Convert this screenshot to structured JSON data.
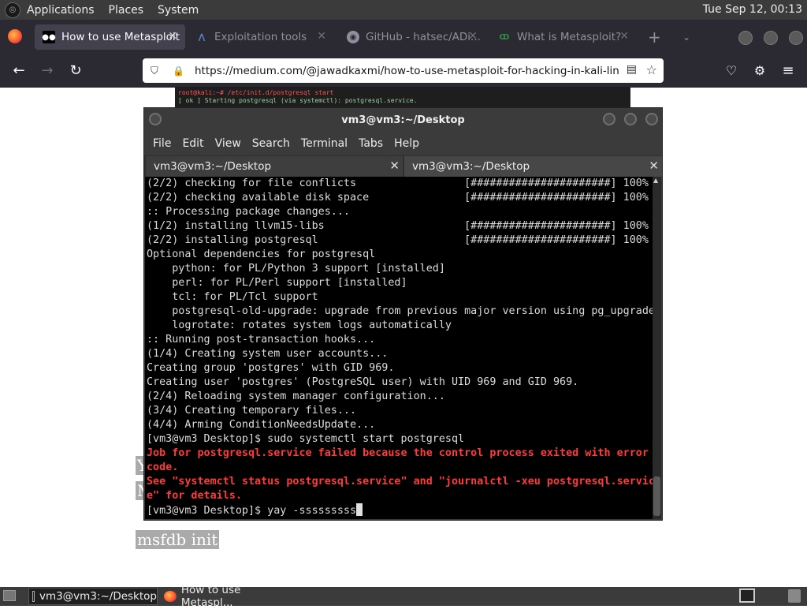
{
  "top_panel": {
    "menus": [
      "Applications",
      "Places",
      "System"
    ],
    "clock": "Tue Sep 12, 00:13"
  },
  "browser": {
    "tabs": [
      {
        "label": "How to use Metasploit",
        "active": true,
        "favicon": "medium-icon"
      },
      {
        "label": "Exploitation tools",
        "active": false,
        "favicon": "kali-icon"
      },
      {
        "label": "GitHub - hatsec/ADi...",
        "active": false,
        "favicon": "github-icon"
      },
      {
        "label": "What is Metasploit?",
        "active": false,
        "favicon": "geeksforgeeks-icon"
      }
    ],
    "new_tab": "+",
    "url": "https://medium.com/@jawadkaxmi/how-to-use-metasploit-for-hacking-in-kali-linux-a",
    "icons": {
      "back": "←",
      "forward": "→",
      "reload": "↻",
      "shield": "⛉",
      "lock": "🔒",
      "reader": "▤",
      "star": "☆",
      "pocket": "♡",
      "extensions": "⚙",
      "menu": "≡"
    }
  },
  "page": {
    "image_cmd_line1": "root@kali:~# /etc/init.d/postgresql start",
    "image_cmd_line2": "[ ok ] Starting postgresql (via systemctl): postgresql.service.",
    "highlight_y": "Y",
    "highlight_m": "M",
    "highlight_msfdb": "msfdb init"
  },
  "terminal": {
    "title": "vm3@vm3:~/Desktop",
    "menu": [
      "File",
      "Edit",
      "View",
      "Search",
      "Terminal",
      "Tabs",
      "Help"
    ],
    "tabs": [
      "vm3@vm3:~/Desktop",
      "vm3@vm3:~/Desktop"
    ],
    "lines": [
      {
        "text": "(2/2) checking for file conflicts                 [######################] 100%",
        "error": false
      },
      {
        "text": "(2/2) checking available disk space               [######################] 100%",
        "error": false
      },
      {
        "text": ":: Processing package changes...",
        "error": false
      },
      {
        "text": "(1/2) installing llvm15-libs                      [######################] 100%",
        "error": false
      },
      {
        "text": "(2/2) installing postgresql                       [######################] 100%",
        "error": false
      },
      {
        "text": "Optional dependencies for postgresql",
        "error": false
      },
      {
        "text": "    python: for PL/Python 3 support [installed]",
        "error": false
      },
      {
        "text": "    perl: for PL/Perl support [installed]",
        "error": false
      },
      {
        "text": "    tcl: for PL/Tcl support",
        "error": false
      },
      {
        "text": "    postgresql-old-upgrade: upgrade from previous major version using pg_upgrade",
        "error": false
      },
      {
        "text": "    logrotate: rotates system logs automatically",
        "error": false
      },
      {
        "text": ":: Running post-transaction hooks...",
        "error": false
      },
      {
        "text": "(1/4) Creating system user accounts...",
        "error": false
      },
      {
        "text": "Creating group 'postgres' with GID 969.",
        "error": false
      },
      {
        "text": "Creating user 'postgres' (PostgreSQL user) with UID 969 and GID 969.",
        "error": false
      },
      {
        "text": "(2/4) Reloading system manager configuration...",
        "error": false
      },
      {
        "text": "(3/4) Creating temporary files...",
        "error": false
      },
      {
        "text": "(4/4) Arming ConditionNeedsUpdate...",
        "error": false
      },
      {
        "text": "[vm3@vm3 Desktop]$ sudo systemctl start postgresql",
        "error": false
      },
      {
        "text": "Job for postgresql.service failed because the control process exited with error",
        "error": true
      },
      {
        "text": "code.",
        "error": true
      },
      {
        "text": "See \"systemctl status postgresql.service\" and \"journalctl -xeu postgresql.servic",
        "error": true
      },
      {
        "text": "e\" for details.",
        "error": true
      }
    ],
    "prompt_line": "[vm3@vm3 Desktop]$ yay -sssssssss"
  },
  "taskbar": {
    "items": [
      "vm3@vm3:~/Desktop",
      "How to use Metaspl..."
    ]
  },
  "colors": {
    "terminal_error": "#ff3b3b",
    "firefox_chrome": "#2b2a33",
    "panel": "#3b3b3b"
  }
}
